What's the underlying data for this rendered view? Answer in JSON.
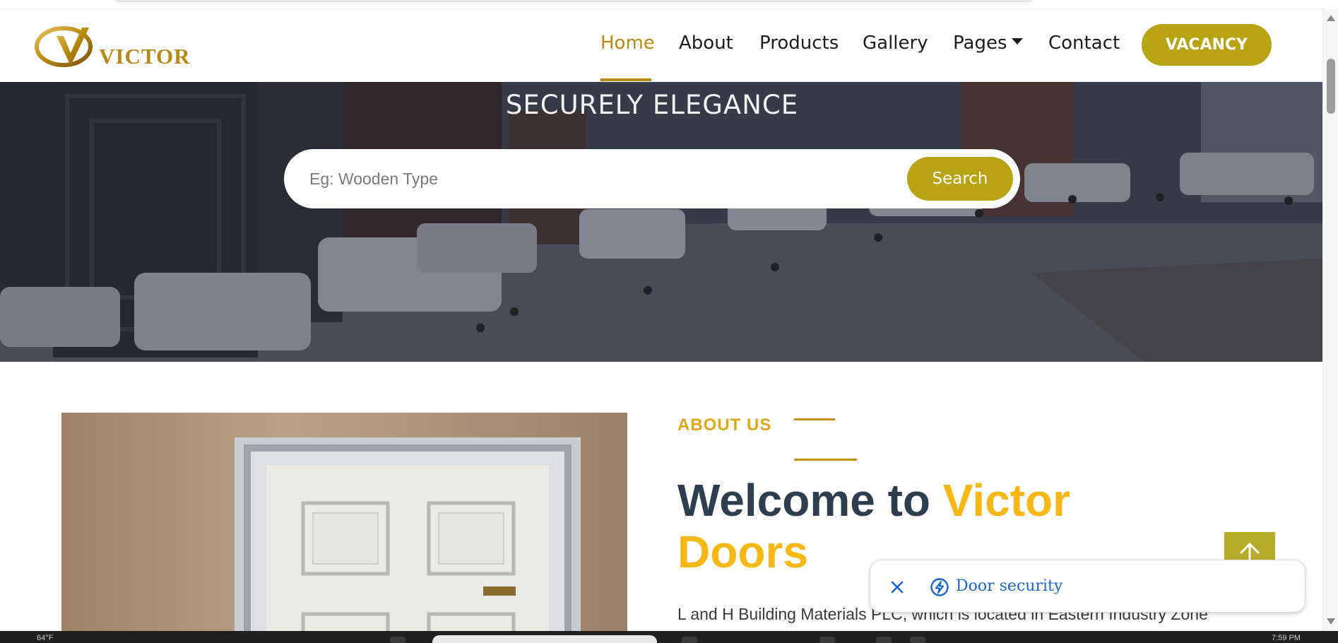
{
  "brand": {
    "logo_text": "VICTOR",
    "accent": "#b9a312",
    "gold": "#b98b12"
  },
  "nav": {
    "items": [
      {
        "label": "Home",
        "active": true
      },
      {
        "label": "About"
      },
      {
        "label": "Products"
      },
      {
        "label": "Gallery"
      },
      {
        "label": "Pages",
        "dropdown": true
      },
      {
        "label": "Contact"
      }
    ],
    "vacancy_label": "VACANCY"
  },
  "hero": {
    "title": "SECURELY ELEGANCE",
    "search_placeholder": "Eg: Wooden Type",
    "search_label": "Search"
  },
  "about": {
    "label": "ABOUT US",
    "heading_part1": "Welcome to ",
    "heading_highlight1": "Victor",
    "heading_highlight2": "Doors",
    "body": "L and H Building Materials PLC, which is located in Eastern Industry Zone"
  },
  "suggestion_chip": {
    "label": "Door security",
    "close_icon": "close-icon",
    "bolt_icon": "bolt-icon"
  },
  "back_to_top": {
    "icon": "arrow-up-icon"
  },
  "taskbar": {
    "left_text": "64°F",
    "right_text": "7:59 PM"
  }
}
